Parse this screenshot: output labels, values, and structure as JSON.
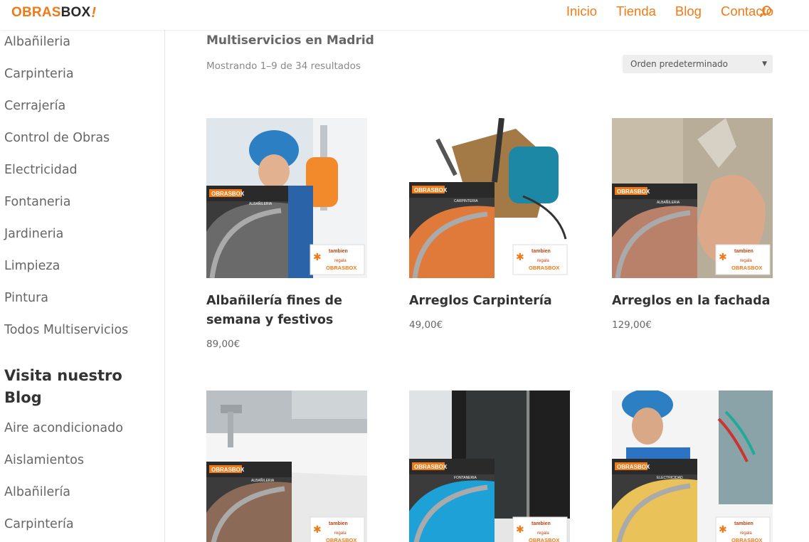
{
  "header": {
    "logo": {
      "part1": "OBRAS",
      "part2": "BOX",
      "part3": "!"
    },
    "nav": [
      "Inicio",
      "Tienda",
      "Blog",
      "Contacto"
    ],
    "search_icon": "search-icon"
  },
  "sidebar": {
    "categories": [
      "Albañileria",
      "Carpinteria",
      "Cerrajería",
      "Control de Obras",
      "Electricidad",
      "Fontaneria",
      "Jardineria",
      "Limpieza",
      "Pintura",
      "Todos Multiservicios"
    ],
    "blog_heading": "Visita nuestro Blog",
    "blog_links": [
      "Aire acondicionado",
      "Aislamientos",
      "Albañilería",
      "Carpintería"
    ]
  },
  "main": {
    "title": "Multiservicios en Madrid",
    "result_count": "Mostrando 1–9 de 34 resultados",
    "orderby": "Orden predeterminado",
    "products": [
      {
        "title": "Albañilería fines de semana y festivos",
        "price": "89,00€",
        "box_label": "ALBAÑILERIA"
      },
      {
        "title": "Arreglos Carpintería",
        "price": "49,00€",
        "box_label": "CARPINTERIA"
      },
      {
        "title": "Arreglos en la fachada",
        "price": "129,00€",
        "box_label": "ALBAÑILERIA"
      },
      {
        "title": "",
        "price": "",
        "box_label": "ALBAÑILERIA"
      },
      {
        "title": "",
        "price": "",
        "box_label": "FONTANERIA"
      },
      {
        "title": "",
        "price": "",
        "box_label": "ELECTRICIDAD"
      }
    ],
    "gift_badge": {
      "line1": "tambien",
      "line2": "regala",
      "line3": "OBRASBOX"
    },
    "box_brand": "OBRASBOX"
  },
  "colors": {
    "accent": "#f07a17",
    "text": "#666666",
    "heading": "#333333"
  }
}
